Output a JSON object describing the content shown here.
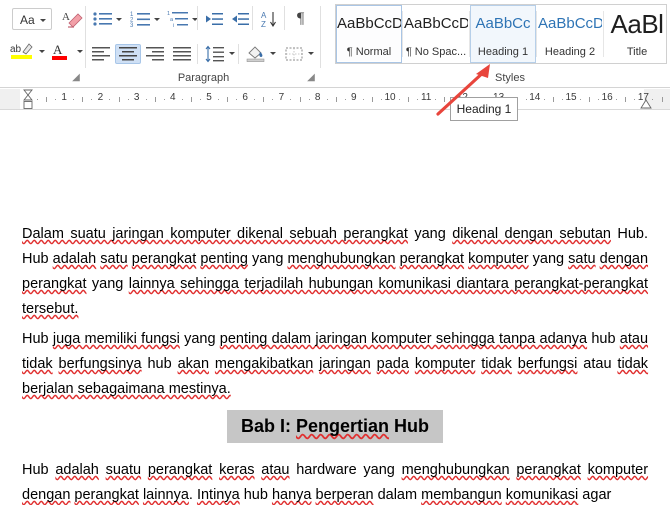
{
  "ribbon": {
    "groups": [
      {
        "name": "font-partial",
        "label": ""
      },
      {
        "name": "paragraph",
        "label": "Paragraph"
      },
      {
        "name": "styles",
        "label": "Styles"
      }
    ],
    "font_group": {
      "change_case_label": "Aa",
      "change_case_name": "change-case-button",
      "clear_formatting_name": "clear-all-formatting-button",
      "highlight_name": "text-highlight-color-button",
      "highlight_color": "#ffff00",
      "font_color_name": "font-color-button",
      "font_color": "#ff0000"
    },
    "paragraph_group": {
      "label": "Paragraph",
      "buttons": [
        {
          "name": "bullets-button",
          "tip": "Bullets"
        },
        {
          "name": "numbering-button",
          "tip": "Numbering"
        },
        {
          "name": "multilevel-list-button",
          "tip": "Multilevel List"
        },
        {
          "name": "decrease-indent-button",
          "tip": "Decrease Indent"
        },
        {
          "name": "increase-indent-button",
          "tip": "Increase Indent"
        },
        {
          "name": "sort-button",
          "tip": "Sort"
        },
        {
          "name": "show-formatting-marks-button",
          "tip": "Show/Hide ¶"
        },
        {
          "name": "align-left-button",
          "tip": "Align Left"
        },
        {
          "name": "align-center-button",
          "tip": "Center",
          "active": true
        },
        {
          "name": "align-right-button",
          "tip": "Align Right"
        },
        {
          "name": "justify-button",
          "tip": "Justify"
        },
        {
          "name": "line-spacing-button",
          "tip": "Line and Paragraph Spacing"
        },
        {
          "name": "shading-button",
          "tip": "Shading"
        },
        {
          "name": "borders-button",
          "tip": "Borders"
        }
      ],
      "pilcrow_glyph": "¶"
    },
    "styles_group": {
      "label": "Styles",
      "tiles": [
        {
          "preview": "AaBbCcDc",
          "name": "¶ Normal",
          "kind": "body",
          "state": "selected"
        },
        {
          "preview": "AaBbCcDc",
          "name": "¶ No Spac...",
          "kind": "body",
          "state": "none"
        },
        {
          "preview": "AaBbCc",
          "name": "Heading 1",
          "kind": "heading",
          "state": "hovered"
        },
        {
          "preview": "AaBbCcD",
          "name": "Heading 2",
          "kind": "heading",
          "state": "none"
        },
        {
          "preview": "AaBl",
          "name": "Title",
          "kind": "title",
          "state": "none"
        }
      ]
    },
    "tooltip": {
      "text": "Heading 1"
    },
    "annotation": {
      "arrow_color": "#e8453c",
      "name": "red-pointer-arrow"
    }
  },
  "ruler": {
    "numbers": [
      1,
      2,
      3,
      4,
      5,
      6,
      7,
      8,
      9,
      10,
      11,
      12,
      13,
      14,
      15,
      16,
      17
    ],
    "left_indent_marker": "left-indent-marker",
    "right_indent_marker": "right-indent-marker"
  },
  "document": {
    "paragraph1": [
      {
        "t": "Dalam suatu jaringan komputer dikenal sebuah perangkat",
        "sp": true
      },
      {
        "t": " yang ",
        "sp": false
      },
      {
        "t": "dikenal dengan sebutan",
        "sp": true
      },
      {
        "t": " Hub. Hub ",
        "sp": false
      },
      {
        "t": "adalah",
        "sp": true
      },
      {
        "t": " ",
        "sp": false
      },
      {
        "t": "satu",
        "sp": true
      },
      {
        "t": " ",
        "sp": false
      },
      {
        "t": "perangkat",
        "sp": true
      },
      {
        "t": " ",
        "sp": false
      },
      {
        "t": "penting",
        "sp": true
      },
      {
        "t": " yang ",
        "sp": false
      },
      {
        "t": "menghubungkan",
        "sp": true
      },
      {
        "t": " ",
        "sp": false
      },
      {
        "t": "perangkat",
        "sp": true
      },
      {
        "t": " ",
        "sp": false
      },
      {
        "t": "komputer",
        "sp": true
      },
      {
        "t": " yang ",
        "sp": false
      },
      {
        "t": "satu",
        "sp": true
      },
      {
        "t": " ",
        "sp": false
      },
      {
        "t": "dengan",
        "sp": true
      },
      {
        "t": " ",
        "sp": false
      },
      {
        "t": "perangkat",
        "sp": true
      },
      {
        "t": " yang ",
        "sp": false
      },
      {
        "t": "lainnya sehingga terjadilah hubungan komunikasi diantara perangkat-perangkat tersebut.",
        "sp": true
      }
    ],
    "paragraph2": [
      {
        "t": "Hub ",
        "sp": false
      },
      {
        "t": "juga memiliki fungsi",
        "sp": true
      },
      {
        "t": " yang ",
        "sp": false
      },
      {
        "t": "penting dalam jaringan komputer sehingga tanpa adanya",
        "sp": true
      },
      {
        "t": " hub ",
        "sp": false
      },
      {
        "t": "atau",
        "sp": true
      },
      {
        "t": " ",
        "sp": false
      },
      {
        "t": "tidak",
        "sp": true
      },
      {
        "t": " ",
        "sp": false
      },
      {
        "t": "berfungsinya",
        "sp": true
      },
      {
        "t": " hub ",
        "sp": false
      },
      {
        "t": "akan",
        "sp": true
      },
      {
        "t": " ",
        "sp": false
      },
      {
        "t": "mengakibatkan",
        "sp": true
      },
      {
        "t": " ",
        "sp": false
      },
      {
        "t": "jaringan",
        "sp": true
      },
      {
        "t": " ",
        "sp": false
      },
      {
        "t": "pada",
        "sp": true
      },
      {
        "t": " ",
        "sp": false
      },
      {
        "t": "komputer",
        "sp": true
      },
      {
        "t": " ",
        "sp": false
      },
      {
        "t": "tidak",
        "sp": true
      },
      {
        "t": " ",
        "sp": false
      },
      {
        "t": "berfungsi",
        "sp": true
      },
      {
        "t": " atau ",
        "sp": false
      },
      {
        "t": "tidak",
        "sp": true
      },
      {
        "t": " ",
        "sp": false
      },
      {
        "t": "berjalan sebagaimana mestinya.",
        "sp": true
      }
    ],
    "heading": [
      {
        "t": "Bab I: ",
        "sp": false
      },
      {
        "t": "Pengertian",
        "sp": true
      },
      {
        "t": " Hub",
        "sp": false
      }
    ],
    "heading_highlight_color": "#c6c6c6",
    "paragraph3": [
      {
        "t": "Hub ",
        "sp": false
      },
      {
        "t": "adalah",
        "sp": true
      },
      {
        "t": " ",
        "sp": false
      },
      {
        "t": "suatu",
        "sp": true
      },
      {
        "t": " ",
        "sp": false
      },
      {
        "t": "perangkat",
        "sp": true
      },
      {
        "t": " ",
        "sp": false
      },
      {
        "t": "keras",
        "sp": true
      },
      {
        "t": " ",
        "sp": false
      },
      {
        "t": "atau",
        "sp": true
      },
      {
        "t": " hardware yang ",
        "sp": false
      },
      {
        "t": "menghubungkan",
        "sp": true
      },
      {
        "t": " ",
        "sp": false
      },
      {
        "t": "perangkat",
        "sp": true
      },
      {
        "t": " ",
        "sp": false
      },
      {
        "t": "komputer",
        "sp": true
      },
      {
        "t": " ",
        "sp": false
      },
      {
        "t": "dengan",
        "sp": true
      },
      {
        "t": " ",
        "sp": false
      },
      {
        "t": "perangkat",
        "sp": true
      },
      {
        "t": " ",
        "sp": false
      },
      {
        "t": "lainnya",
        "sp": true
      },
      {
        "t": ". ",
        "sp": false
      },
      {
        "t": "Intinya",
        "sp": true
      },
      {
        "t": " hub ",
        "sp": false
      },
      {
        "t": "hanya",
        "sp": true
      },
      {
        "t": " ",
        "sp": false
      },
      {
        "t": "berperan",
        "sp": true
      },
      {
        "t": " dalam ",
        "sp": false
      },
      {
        "t": "membangun",
        "sp": true
      },
      {
        "t": " ",
        "sp": false
      },
      {
        "t": "komunikasi",
        "sp": true
      },
      {
        "t": " agar",
        "sp": false
      }
    ],
    "spellcheck_underline_color": "#e03030"
  }
}
